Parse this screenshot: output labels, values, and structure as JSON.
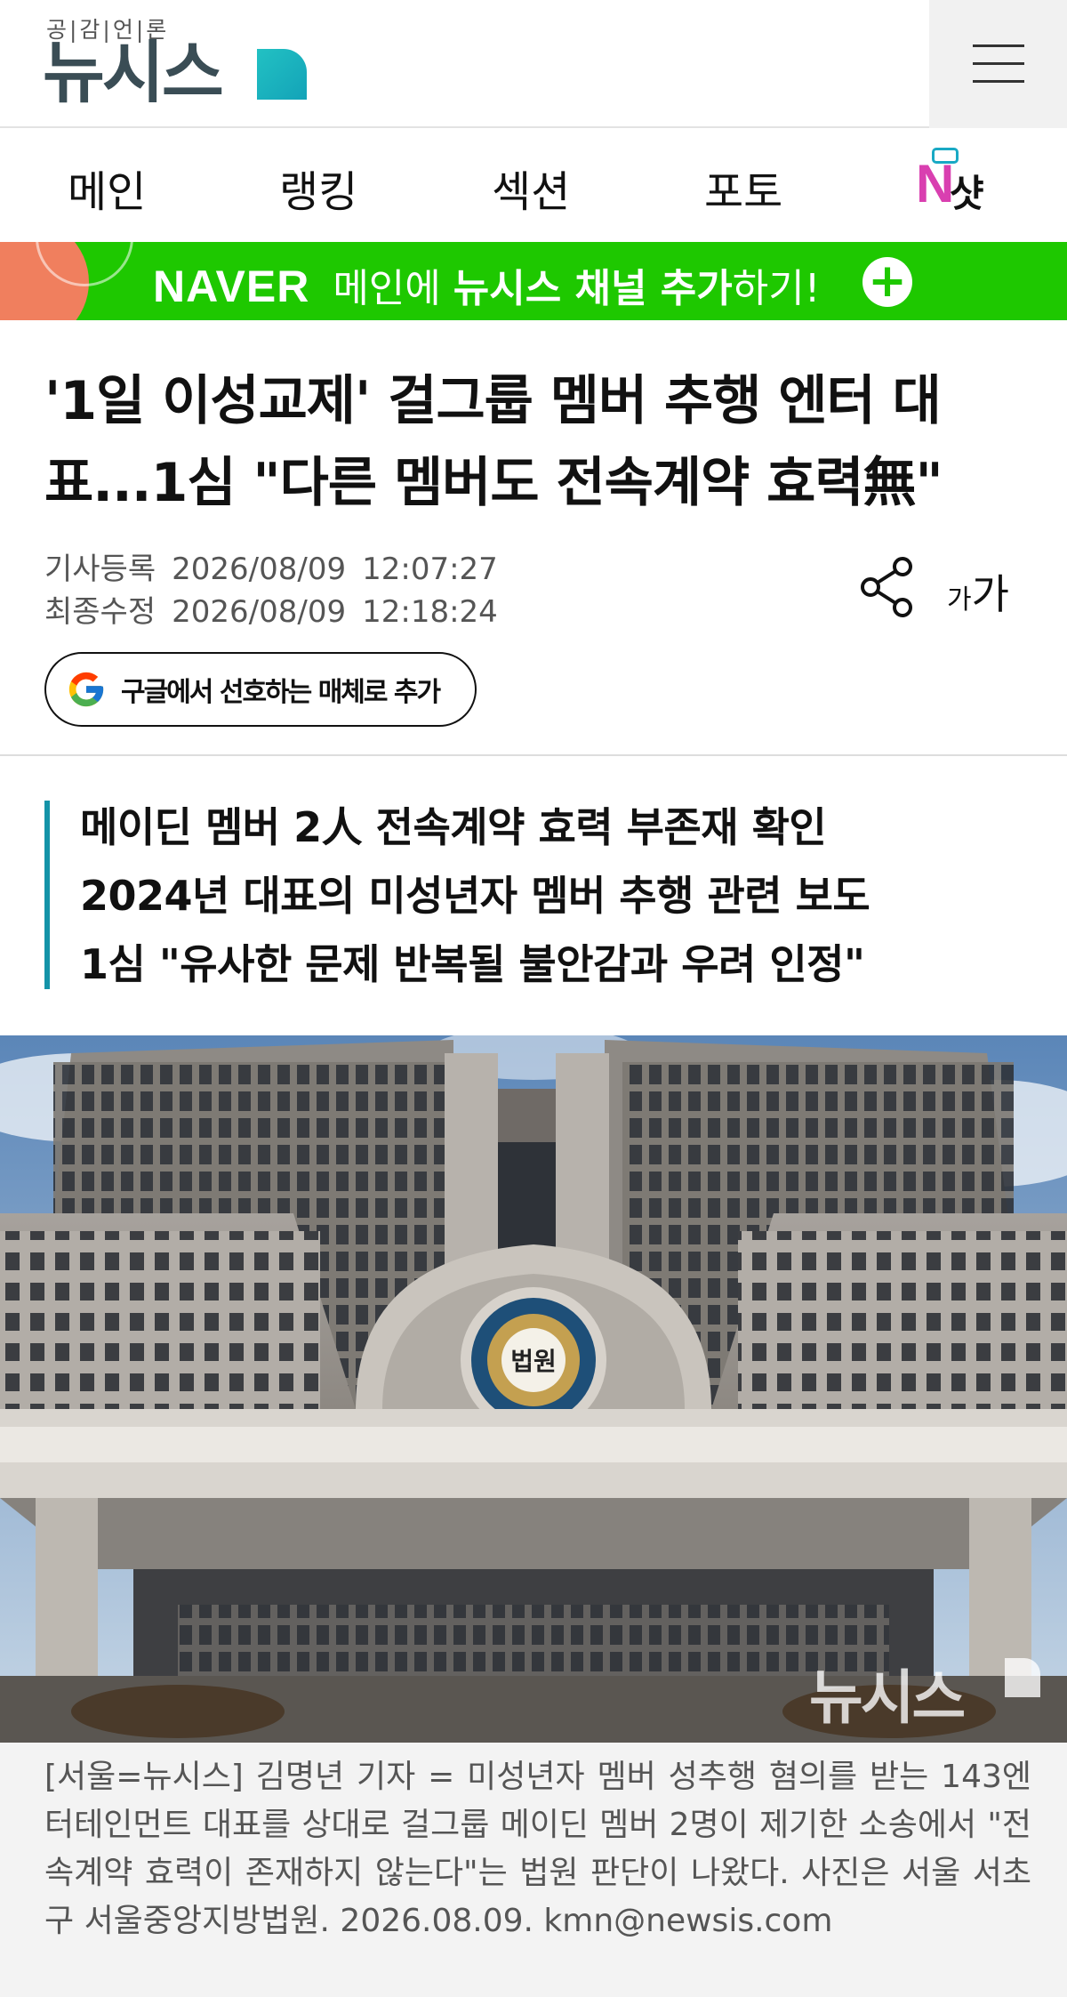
{
  "header": {
    "logo_tag": "공|감|언|론",
    "logo_text": "뉴시스",
    "menu_icon": "hamburger-icon"
  },
  "nav": {
    "items": [
      "메인",
      "랭킹",
      "섹션",
      "포토"
    ],
    "shot_n": "N",
    "shot_label": "샷"
  },
  "banner": {
    "naver": "NAVER",
    "text1": " 메인에 ",
    "text2": "뉴시스 채널 추가",
    "text3": "하기!",
    "plus": "+",
    "color": "#1ec800"
  },
  "article": {
    "title": "'1일 이성교제' 걸그룹 멤버 추행 엔터 대표...1심 \"다른 멤버도 전속계약 효력無\"",
    "registered_label": "기사등록",
    "registered_date": "2026/08/09",
    "registered_time": "12:07:27",
    "modified_label": "최종수정",
    "modified_date": "2026/08/09",
    "modified_time": "12:18:24",
    "font_small": "가",
    "font_large": "가",
    "google_button": "구글에서 선호하는 매체로 추가",
    "summary": [
      "메이딘 멤버 2人 전속계약 효력 부존재 확인",
      "2024년 대표의 미성년자 멤버 추행 관련 보도",
      "1심 \"유사한 문제 반복될 불안감과 우려 인정\""
    ],
    "photo_watermark": "뉴시스",
    "photo_seal": "법원",
    "caption": "[서울=뉴시스] 김명년 기자 = 미성년자 멤버 성추행 혐의를 받는 143엔터테인먼트 대표를 상대로 걸그룹 메이딘 멤버 2명이 제기한 소송에서 \"전속계약 효력이 존재하지 않는다\"는 법원 판단이 나왔다.  사진은 서울 서초구 서울중앙지방법원. 2026.08.09. kmn@newsis.com"
  },
  "colors": {
    "accent": "#1493a8",
    "logo": "#3a4d55"
  }
}
